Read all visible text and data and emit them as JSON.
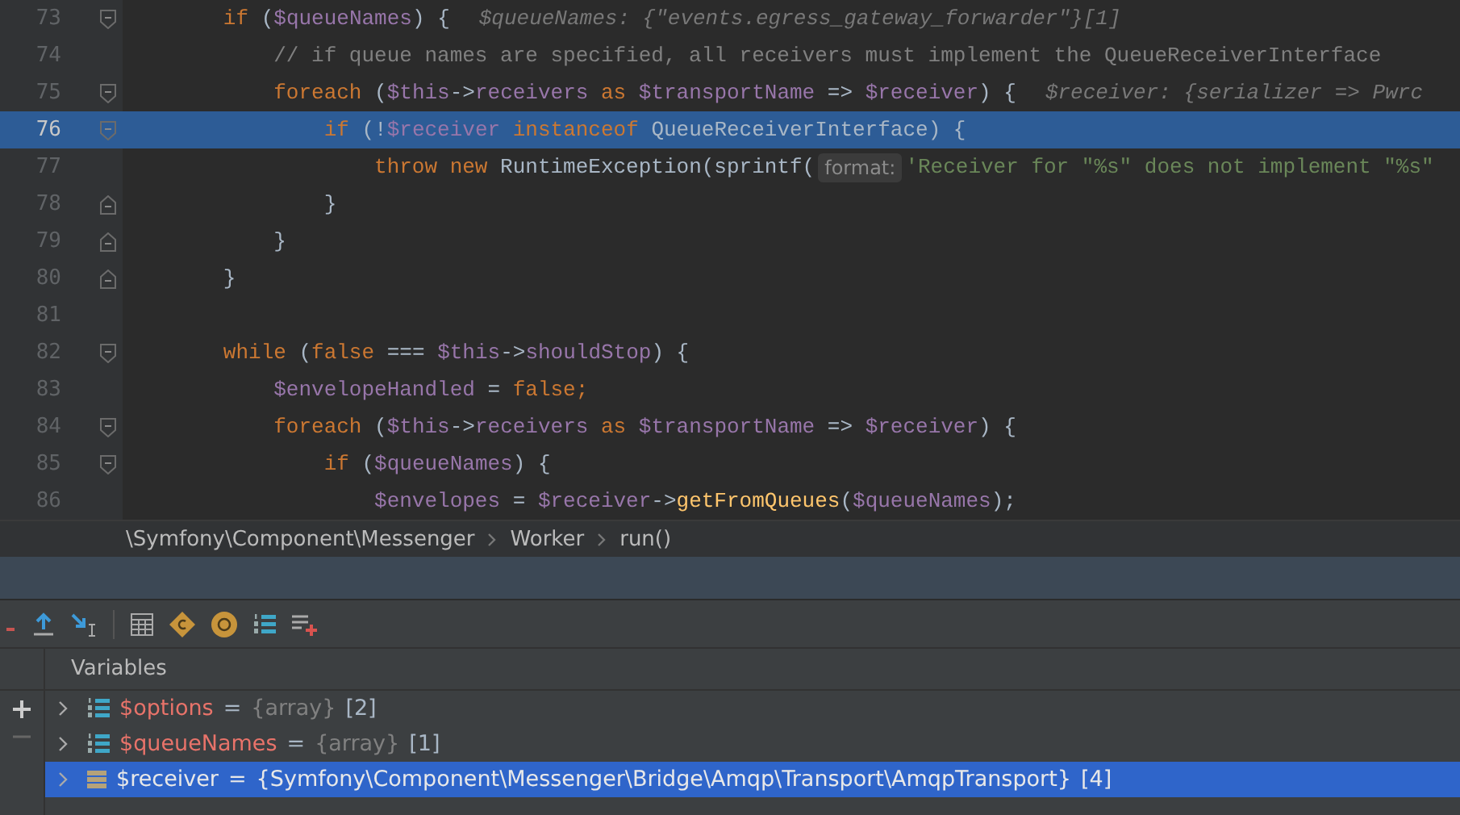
{
  "editor": {
    "lines": [
      {
        "number": "73",
        "selected": false,
        "fold_start": true,
        "fold_end": false,
        "segments": [
          {
            "kind": "code",
            "tokens": [
              {
                "kind": "kw",
                "text": "        if "
              },
              {
                "kind": "plain",
                "text": "("
              },
              {
                "kind": "var",
                "text": "$queueNames"
              },
              {
                "kind": "plain",
                "text": ") {"
              }
            ]
          },
          {
            "kind": "hint",
            "text": "$queueNames: {\"events.egress_gateway_forwarder\"}[1]"
          }
        ]
      },
      {
        "number": "74",
        "selected": false,
        "fold_start": false,
        "fold_end": false,
        "segments": [
          {
            "kind": "code",
            "tokens": [
              {
                "kind": "comment",
                "text": "            // if queue names are specified, all receivers must implement the QueueReceiverInterface"
              }
            ]
          }
        ]
      },
      {
        "number": "75",
        "selected": false,
        "fold_start": true,
        "fold_end": false,
        "segments": [
          {
            "kind": "code",
            "tokens": [
              {
                "kind": "kw",
                "text": "            foreach "
              },
              {
                "kind": "plain",
                "text": "("
              },
              {
                "kind": "var",
                "text": "$this"
              },
              {
                "kind": "plain",
                "text": "->"
              },
              {
                "kind": "var",
                "text": "receivers "
              },
              {
                "kind": "kw",
                "text": "as "
              },
              {
                "kind": "var",
                "text": "$transportName"
              },
              {
                "kind": "plain",
                "text": " => "
              },
              {
                "kind": "var",
                "text": "$receiver"
              },
              {
                "kind": "plain",
                "text": ") {"
              }
            ]
          },
          {
            "kind": "hint",
            "text": "$receiver: {serializer => Pwrc"
          }
        ]
      },
      {
        "number": "76",
        "selected": true,
        "fold_start": true,
        "fold_end": false,
        "segments": [
          {
            "kind": "code",
            "tokens": [
              {
                "kind": "kw",
                "text": "                if "
              },
              {
                "kind": "plain",
                "text": "(!"
              },
              {
                "kind": "var",
                "text": "$receiver "
              },
              {
                "kind": "kw",
                "text": "instanceof "
              },
              {
                "kind": "plain",
                "text": "QueueReceiverInterface) {"
              }
            ]
          }
        ]
      },
      {
        "number": "77",
        "selected": false,
        "fold_start": false,
        "fold_end": false,
        "segments": [
          {
            "kind": "code",
            "tokens": [
              {
                "kind": "kw",
                "text": "                    throw new "
              },
              {
                "kind": "plain",
                "text": "RuntimeException(sprintf("
              }
            ]
          },
          {
            "kind": "inlay",
            "text": "format:"
          },
          {
            "kind": "code",
            "tokens": [
              {
                "kind": "str",
                "text": "'Receiver for \"%s\" does not implement \"%s\""
              }
            ]
          }
        ]
      },
      {
        "number": "78",
        "selected": false,
        "fold_start": false,
        "fold_end": true,
        "segments": [
          {
            "kind": "code",
            "tokens": [
              {
                "kind": "plain",
                "text": "                }"
              }
            ]
          }
        ]
      },
      {
        "number": "79",
        "selected": false,
        "fold_start": false,
        "fold_end": true,
        "segments": [
          {
            "kind": "code",
            "tokens": [
              {
                "kind": "plain",
                "text": "            }"
              }
            ]
          }
        ]
      },
      {
        "number": "80",
        "selected": false,
        "fold_start": false,
        "fold_end": true,
        "segments": [
          {
            "kind": "code",
            "tokens": [
              {
                "kind": "plain",
                "text": "        }"
              }
            ]
          }
        ]
      },
      {
        "number": "81",
        "selected": false,
        "fold_start": false,
        "fold_end": false
      },
      {
        "number": "82",
        "selected": false,
        "fold_start": true,
        "fold_end": false,
        "segments": [
          {
            "kind": "code",
            "tokens": [
              {
                "kind": "kw",
                "text": "        while "
              },
              {
                "kind": "plain",
                "text": "("
              },
              {
                "kind": "kw",
                "text": "false "
              },
              {
                "kind": "plain",
                "text": "=== "
              },
              {
                "kind": "var",
                "text": "$this"
              },
              {
                "kind": "plain",
                "text": "->"
              },
              {
                "kind": "var",
                "text": "shouldStop"
              },
              {
                "kind": "plain",
                "text": ") {"
              }
            ]
          }
        ]
      },
      {
        "number": "83",
        "selected": false,
        "fold_start": false,
        "fold_end": false,
        "segments": [
          {
            "kind": "code",
            "tokens": [
              {
                "kind": "var",
                "text": "            $envelopeHandled"
              },
              {
                "kind": "plain",
                "text": " = "
              },
              {
                "kind": "kw",
                "text": "false;"
              }
            ]
          }
        ]
      },
      {
        "number": "84",
        "selected": false,
        "fold_start": true,
        "fold_end": false,
        "segments": [
          {
            "kind": "code",
            "tokens": [
              {
                "kind": "kw",
                "text": "            foreach "
              },
              {
                "kind": "plain",
                "text": "("
              },
              {
                "kind": "var",
                "text": "$this"
              },
              {
                "kind": "plain",
                "text": "->"
              },
              {
                "kind": "var",
                "text": "receivers "
              },
              {
                "kind": "kw",
                "text": "as "
              },
              {
                "kind": "var",
                "text": "$transportName"
              },
              {
                "kind": "plain",
                "text": " => "
              },
              {
                "kind": "var",
                "text": "$receiver"
              },
              {
                "kind": "plain",
                "text": ") {"
              }
            ]
          }
        ]
      },
      {
        "number": "85",
        "selected": false,
        "fold_start": true,
        "fold_end": false,
        "segments": [
          {
            "kind": "code",
            "tokens": [
              {
                "kind": "kw",
                "text": "                if "
              },
              {
                "kind": "plain",
                "text": "("
              },
              {
                "kind": "var",
                "text": "$queueNames"
              },
              {
                "kind": "plain",
                "text": ") {"
              }
            ]
          }
        ]
      },
      {
        "number": "86",
        "selected": false,
        "fold_start": false,
        "fold_end": false,
        "segments": [
          {
            "kind": "code",
            "tokens": [
              {
                "kind": "var",
                "text": "                    $envelopes"
              },
              {
                "kind": "plain",
                "text": " = "
              },
              {
                "kind": "var",
                "text": "$receiver"
              },
              {
                "kind": "plain",
                "text": "->"
              },
              {
                "kind": "fn",
                "text": "getFromQueues"
              },
              {
                "kind": "plain",
                "text": "("
              },
              {
                "kind": "var",
                "text": "$queueNames"
              },
              {
                "kind": "plain",
                "text": ");"
              }
            ]
          }
        ]
      }
    ]
  },
  "breadcrumb": [
    "\\Symfony\\Component\\Messenger",
    "Worker",
    "run()"
  ],
  "debugger": {
    "panel_title": "Variables",
    "variables": [
      {
        "kind": "array",
        "name": "$options",
        "separator": "=",
        "type": "{array}",
        "count": "[2]",
        "selected": false
      },
      {
        "kind": "array",
        "name": "$queueNames",
        "separator": "=",
        "type": "{array}",
        "count": "[1]",
        "selected": false
      },
      {
        "kind": "object",
        "name": "$receiver",
        "separator": "=",
        "type": "{Symfony\\Component\\Messenger\\Bridge\\Amqp\\Transport\\AmqpTransport}",
        "count": "[4]",
        "selected": true
      }
    ]
  }
}
